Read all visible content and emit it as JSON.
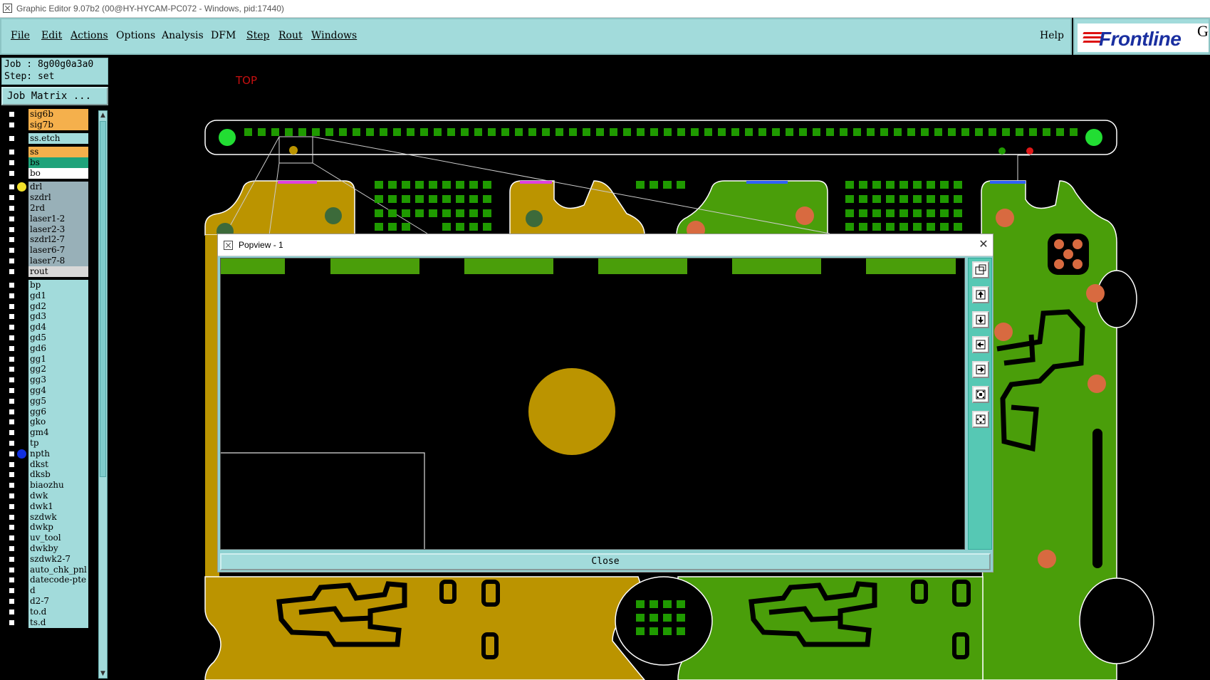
{
  "window": {
    "title": "Graphic Editor 9.07b2 (00@HY-HYCAM-PC072 - Windows, pid:17440)"
  },
  "menu": {
    "file": "File",
    "edit": "Edit",
    "actions": "Actions",
    "options": "Options",
    "analysis": "Analysis",
    "dfm": "DFM",
    "step": "Step",
    "rout": "Rout",
    "windows": "Windows",
    "help": "Help"
  },
  "brand": {
    "logo": "Frontline",
    "ge": "Ge"
  },
  "job": {
    "job_line": "Job : 8g00g0a3a0",
    "step_line": "Step: set",
    "matrix_button": "Job Matrix ..."
  },
  "layers": [
    {
      "name": "sig6b",
      "color": "#f5b04c",
      "dot": ""
    },
    {
      "name": "sig7b",
      "color": "#f5b04c",
      "dot": ""
    },
    {
      "name": "ss.etch",
      "color": "#a2dbdb",
      "dot": ""
    },
    {
      "name": "ss",
      "color": "#f5b04c",
      "dot": ""
    },
    {
      "name": "bs",
      "color": "#1fa37a",
      "dot": ""
    },
    {
      "name": "bo",
      "color": "#ffffff",
      "dot": ""
    },
    {
      "name": "drl",
      "color": "#98b0b8",
      "dot": "#f2e02a"
    },
    {
      "name": "szdrl",
      "color": "#98b0b8",
      "dot": ""
    },
    {
      "name": "2rd",
      "color": "#98b0b8",
      "dot": ""
    },
    {
      "name": "laser1-2",
      "color": "#98b0b8",
      "dot": ""
    },
    {
      "name": "laser2-3",
      "color": "#98b0b8",
      "dot": ""
    },
    {
      "name": "szdrl2-7",
      "color": "#98b0b8",
      "dot": ""
    },
    {
      "name": "laser6-7",
      "color": "#98b0b8",
      "dot": ""
    },
    {
      "name": "laser7-8",
      "color": "#98b0b8",
      "dot": ""
    },
    {
      "name": "rout",
      "color": "#d8d8d8",
      "dot": ""
    },
    {
      "name": "bp",
      "color": "#a2dbdb",
      "dot": ""
    },
    {
      "name": "gd1",
      "color": "#a2dbdb",
      "dot": ""
    },
    {
      "name": "gd2",
      "color": "#a2dbdb",
      "dot": ""
    },
    {
      "name": "gd3",
      "color": "#a2dbdb",
      "dot": ""
    },
    {
      "name": "gd4",
      "color": "#a2dbdb",
      "dot": ""
    },
    {
      "name": "gd5",
      "color": "#a2dbdb",
      "dot": ""
    },
    {
      "name": "gd6",
      "color": "#a2dbdb",
      "dot": ""
    },
    {
      "name": "gg1",
      "color": "#a2dbdb",
      "dot": ""
    },
    {
      "name": "gg2",
      "color": "#a2dbdb",
      "dot": ""
    },
    {
      "name": "gg3",
      "color": "#a2dbdb",
      "dot": ""
    },
    {
      "name": "gg4",
      "color": "#a2dbdb",
      "dot": ""
    },
    {
      "name": "gg5",
      "color": "#a2dbdb",
      "dot": ""
    },
    {
      "name": "gg6",
      "color": "#a2dbdb",
      "dot": ""
    },
    {
      "name": "gko",
      "color": "#a2dbdb",
      "dot": ""
    },
    {
      "name": "gm4",
      "color": "#a2dbdb",
      "dot": ""
    },
    {
      "name": "tp",
      "color": "#a2dbdb",
      "dot": ""
    },
    {
      "name": "npth",
      "color": "#a2dbdb",
      "dot": "#1030e0"
    },
    {
      "name": "dkst",
      "color": "#a2dbdb",
      "dot": ""
    },
    {
      "name": "dksb",
      "color": "#a2dbdb",
      "dot": ""
    },
    {
      "name": "biaozhu",
      "color": "#a2dbdb",
      "dot": ""
    },
    {
      "name": "dwk",
      "color": "#a2dbdb",
      "dot": ""
    },
    {
      "name": "dwk1",
      "color": "#a2dbdb",
      "dot": ""
    },
    {
      "name": "szdwk",
      "color": "#a2dbdb",
      "dot": ""
    },
    {
      "name": "dwkp",
      "color": "#a2dbdb",
      "dot": ""
    },
    {
      "name": "uv_tool",
      "color": "#a2dbdb",
      "dot": ""
    },
    {
      "name": "dwkby",
      "color": "#a2dbdb",
      "dot": ""
    },
    {
      "name": "szdwk2-7",
      "color": "#a2dbdb",
      "dot": ""
    },
    {
      "name": "auto_chk_pnl",
      "color": "#a2dbdb",
      "dot": ""
    },
    {
      "name": "datecode-pte",
      "color": "#a2dbdb",
      "dot": ""
    },
    {
      "name": "d",
      "color": "#a2dbdb",
      "dot": ""
    },
    {
      "name": "d2-7",
      "color": "#a2dbdb",
      "dot": ""
    },
    {
      "name": "to.d",
      "color": "#a2dbdb",
      "dot": ""
    },
    {
      "name": "ts.d",
      "color": "#a2dbdb",
      "dot": ""
    }
  ],
  "canvas": {
    "side_label": "TOP"
  },
  "popview": {
    "title": "Popview - 1",
    "close_button": "Close"
  },
  "colors": {
    "gold": "#bb9400",
    "green": "#4a9e0a",
    "pad_green": "#1f9a00",
    "orange": "#d86a40"
  }
}
